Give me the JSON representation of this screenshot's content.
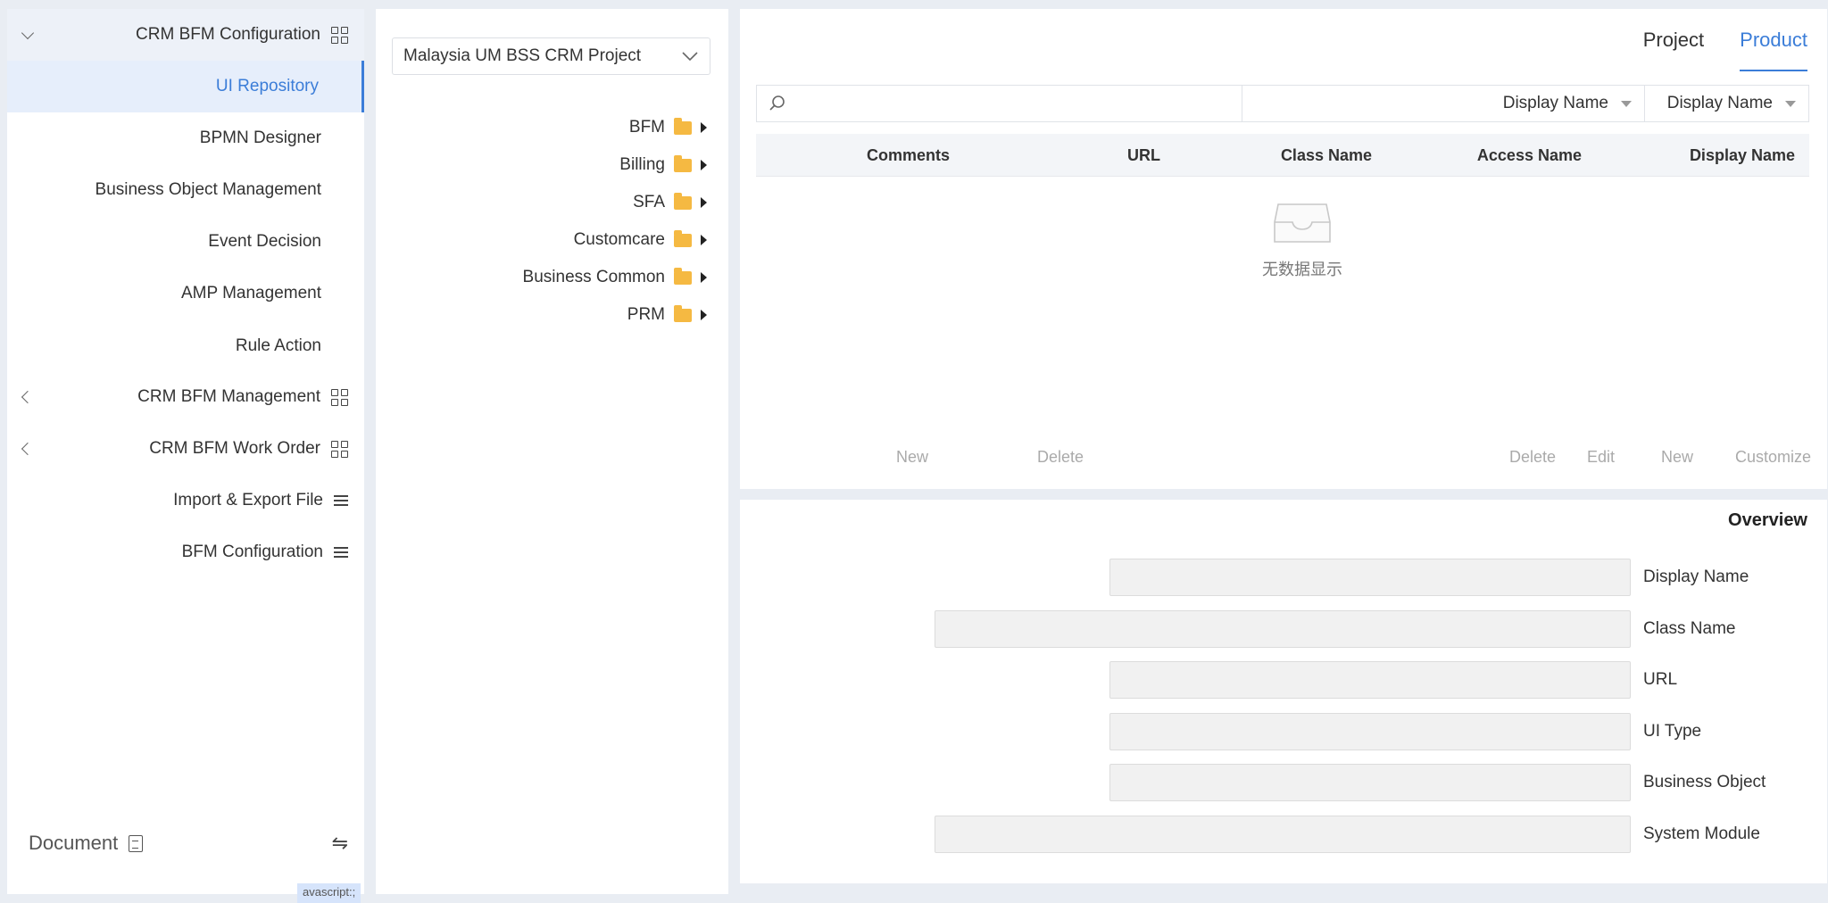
{
  "tabs": [
    "Product",
    "Project"
  ],
  "filter": {
    "field_select": "Display Name",
    "condition_select": "Display Name",
    "search_placeholder": ""
  },
  "table": {
    "columns": [
      "Display Name",
      "Access Name",
      "Class Name",
      "URL",
      "Comments"
    ],
    "rows": [],
    "empty_text": "无数据显示"
  },
  "actions": {
    "left": [
      "Customize",
      "New",
      "Edit",
      "Delete"
    ],
    "right": [
      "Delete",
      "New"
    ]
  },
  "overview": {
    "title": "Overview",
    "fields": [
      {
        "label": "Display Name",
        "value": ""
      },
      {
        "label": "Class Name",
        "value": ""
      },
      {
        "label": "URL",
        "value": ""
      },
      {
        "label": "UI Type",
        "value": ""
      },
      {
        "label": "Business Object",
        "value": ""
      },
      {
        "label": "System Module",
        "value": ""
      }
    ]
  },
  "project": {
    "selected": "Malaysia UM BSS CRM Project",
    "tree": [
      "BFM",
      "Billing",
      "SFA",
      "Customcare",
      "Business Common",
      "PRM"
    ]
  },
  "sidebar": {
    "group_open": "CRM BFM Configuration",
    "sub_items": [
      "UI Repository",
      "BPMN Designer",
      "Business Object Management",
      "Event Decision",
      "AMP Management",
      "Rule Action"
    ],
    "groups": [
      "CRM BFM Management",
      "CRM BFM Work Order"
    ],
    "links": [
      "Import & Export File",
      "BFM Configuration"
    ],
    "footer": "Document"
  },
  "status_tag": "avascript:;",
  "colors": {
    "accent": "#3b7dd8",
    "folder": "#f5b942",
    "background": "#e9edf3"
  }
}
